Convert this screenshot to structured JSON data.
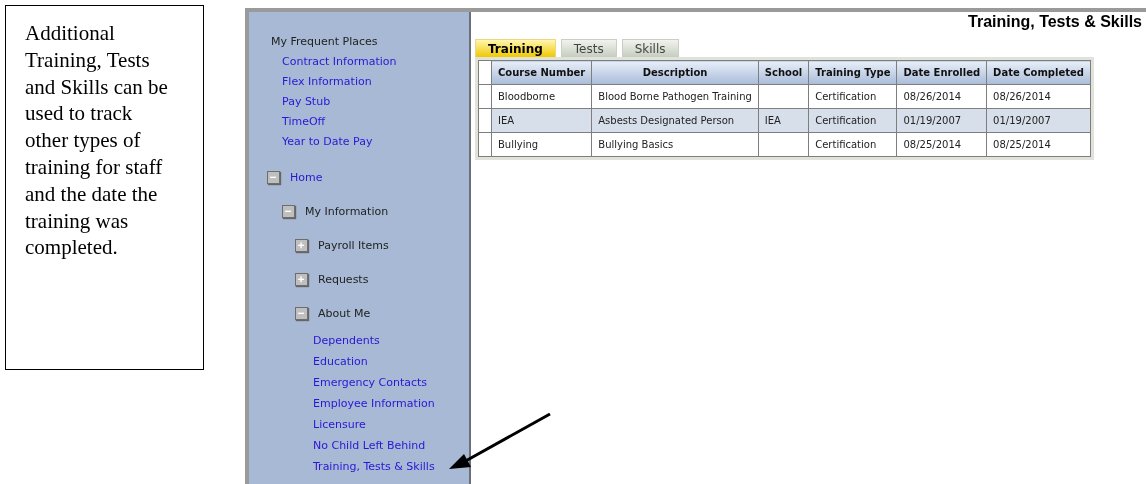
{
  "callout": {
    "text": "Additional Training, Tests and Skills can be used to track other types of training for staff and the date the training was completed."
  },
  "sidebar": {
    "frequent_heading": "My Frequent Places",
    "frequent_links": [
      "Contract Information",
      "Flex Information",
      "Pay Stub",
      "TimeOff",
      "Year to Date Pay"
    ],
    "tree": [
      {
        "kind": "folder",
        "label": "Home",
        "expanded": true,
        "children": [
          {
            "kind": "folder",
            "label": "My Information",
            "expanded": true,
            "children": [
              {
                "kind": "folder",
                "label": "Payroll Items",
                "expanded": false
              },
              {
                "kind": "folder",
                "label": "Requests",
                "expanded": false
              },
              {
                "kind": "folder",
                "label": "About Me",
                "expanded": true,
                "children": [
                  {
                    "kind": "link",
                    "label": "Dependents"
                  },
                  {
                    "kind": "link",
                    "label": "Education"
                  },
                  {
                    "kind": "link",
                    "label": "Emergency Contacts"
                  },
                  {
                    "kind": "link",
                    "label": "Employee Information"
                  },
                  {
                    "kind": "link",
                    "label": "Licensure"
                  },
                  {
                    "kind": "link",
                    "label": "No Child Left Behind"
                  },
                  {
                    "kind": "link",
                    "label": "Training, Tests & Skills"
                  }
                ]
              }
            ]
          }
        ]
      }
    ]
  },
  "page_title": "Training, Tests & Skills",
  "tabs": [
    {
      "label": "Training",
      "selected": true
    },
    {
      "label": "Tests",
      "selected": false
    },
    {
      "label": "Skills",
      "selected": false
    }
  ],
  "table": {
    "columns": [
      "Course Number",
      "Description",
      "School",
      "Training Type",
      "Date Enrolled",
      "Date Completed"
    ],
    "rows": [
      [
        "Bloodborne",
        "Blood Borne Pathogen Training",
        "",
        "Certification",
        "08/26/2014",
        "08/26/2014"
      ],
      [
        "IEA",
        "Asbests Designated Person",
        "IEA",
        "Certification",
        "01/19/2007",
        "01/19/2007"
      ],
      [
        "Bullying",
        "Bullying Basics",
        "",
        "Certification",
        "08/25/2014",
        "08/25/2014"
      ]
    ]
  }
}
